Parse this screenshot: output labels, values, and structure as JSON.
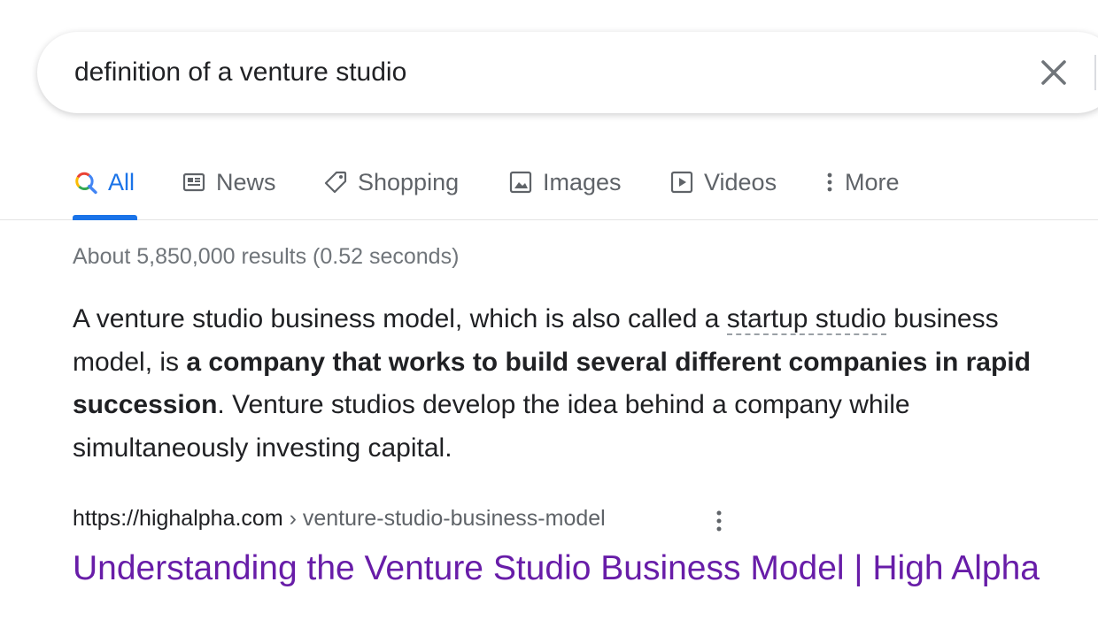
{
  "search": {
    "query": "definition of a venture studio"
  },
  "tabs": [
    {
      "label": "All",
      "icon": "search-multicolor-icon",
      "active": true
    },
    {
      "label": "News",
      "icon": "newspaper-icon",
      "active": false
    },
    {
      "label": "Shopping",
      "icon": "tag-icon",
      "active": false
    },
    {
      "label": "Images",
      "icon": "image-icon",
      "active": false
    },
    {
      "label": "Videos",
      "icon": "play-box-icon",
      "active": false
    },
    {
      "label": "More",
      "icon": "more-vert-icon",
      "active": false
    }
  ],
  "colors": {
    "accent": "#1a73e8",
    "visited_link": "#681da8",
    "text": "#202124",
    "muted": "#70757a"
  },
  "results": {
    "stats": "About 5,850,000 results (0.52 seconds)"
  },
  "snippet": {
    "part1": "A venture studio business model, which is also called a ",
    "term": "startup studio",
    "part2": " business model, is ",
    "bold": "a company that works to build several different companies in rapid succession",
    "part3": ". Venture studios develop the idea behind a company while simultaneously investing capital."
  },
  "source": {
    "url": "https://highalpha.com",
    "path": " › venture-studio-business-model",
    "title": "Understanding the Venture Studio Business Model | High Alpha"
  }
}
